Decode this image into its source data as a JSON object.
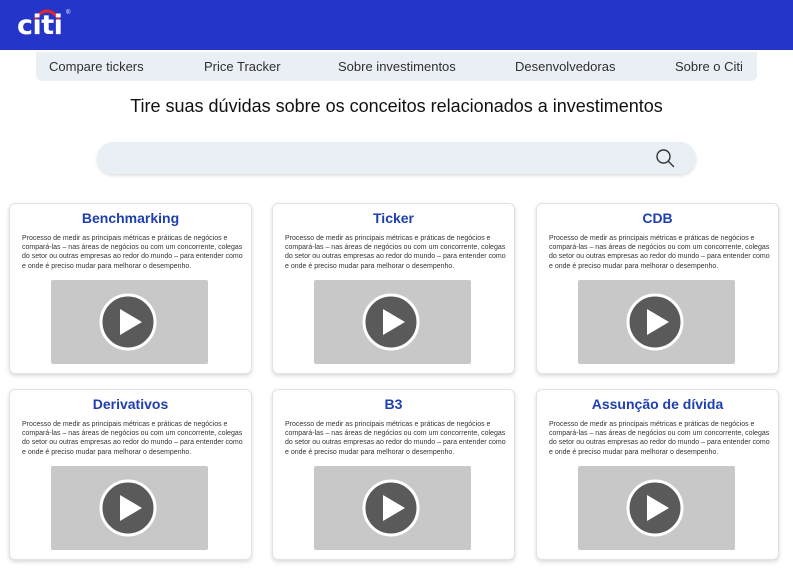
{
  "header": {
    "logo_text": "citi",
    "logo_mark": "®"
  },
  "nav": {
    "items": [
      {
        "label": "Compare tickers"
      },
      {
        "label": "Price Tracker"
      },
      {
        "label": "Sobre investimentos"
      },
      {
        "label": "Desenvolvedoras"
      },
      {
        "label": "Sobre o Citi"
      }
    ]
  },
  "main": {
    "title": "Tire suas dúvidas sobre os conceitos relacionados a investimentos",
    "search": {
      "value": "",
      "placeholder": "",
      "icon": "search-icon"
    },
    "cards": [
      {
        "title": "Benchmarking",
        "description": "Processo de medir as principais métricas e práticas de negócios e compará-las – nas áreas de negócios ou com um concorrente, colegas do setor ou outras empresas ao redor do mundo – para entender como e onde é preciso mudar para melhorar o desempenho.",
        "video_icon": "play-icon"
      },
      {
        "title": "Ticker",
        "description": "Processo de medir as principais métricas e práticas de negócios e compará-las – nas áreas de negócios ou com um concorrente, colegas do setor ou outras empresas ao redor do mundo – para entender como e onde é preciso mudar para melhorar o desempenho.",
        "video_icon": "play-icon"
      },
      {
        "title": "CDB",
        "description": "Processo de medir as principais métricas e práticas de negócios e compará-las – nas áreas de negócios ou com um concorrente, colegas do setor ou outras empresas ao redor do mundo – para entender como e onde é preciso mudar para melhorar o desempenho.",
        "video_icon": "play-icon"
      },
      {
        "title": "Derivativos",
        "description": "Processo de medir as principais métricas e práticas de negócios e compará-las – nas áreas de negócios ou com um concorrente, colegas do setor ou outras empresas ao redor do mundo – para entender como e onde é preciso mudar para melhorar o desempenho.",
        "video_icon": "play-icon"
      },
      {
        "title": "B3",
        "description": "Processo de medir as principais métricas e práticas de negócios e compará-las – nas áreas de negócios ou com um concorrente, colegas do setor ou outras empresas ao redor do mundo – para entender como e onde é preciso mudar para melhorar o desempenho.",
        "video_icon": "play-icon"
      },
      {
        "title": "Assunção de dívida",
        "description": "Processo de medir as principais métricas e práticas de negócios e compará-las – nas áreas de negócios ou com um concorrente, colegas do setor ou outras empresas ao redor do mundo – para entender como e onde é preciso mudar para melhorar o desempenho.",
        "video_icon": "play-icon"
      }
    ]
  },
  "colors": {
    "header_bg": "#2534c9",
    "nav_bg": "#eaeff6",
    "card_title": "#1f3fb0",
    "video_bg": "#c8c8c8",
    "play_circle": "#5a5a5a"
  }
}
